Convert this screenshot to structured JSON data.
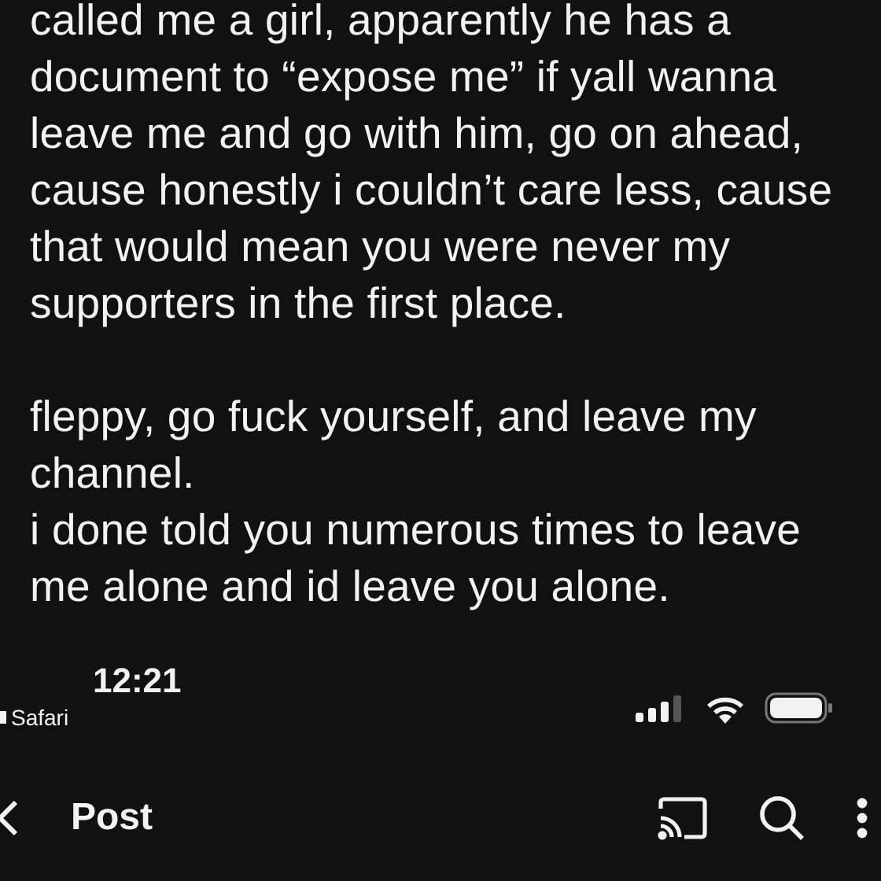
{
  "post_text": [
    {
      "lines": [
        "called me a girl, apparently he has a",
        "document to “expose me” if yall wanna",
        "leave me and go with him, go on ahead,",
        "cause honestly i couldn’t care less, cause",
        "that would mean you were never my",
        "supporters in the first place."
      ],
      "gap_before": false
    },
    {
      "lines": [
        "fleppy, go fuck yourself, and leave my",
        "channel."
      ],
      "gap_before": true
    },
    {
      "lines": [
        "i done told you numerous times to leave",
        "me alone and id leave you alone."
      ],
      "gap_before": false
    }
  ],
  "status_bar": {
    "time": "12:21",
    "back_app": "Safari"
  },
  "nav_bar": {
    "title": "Post"
  }
}
